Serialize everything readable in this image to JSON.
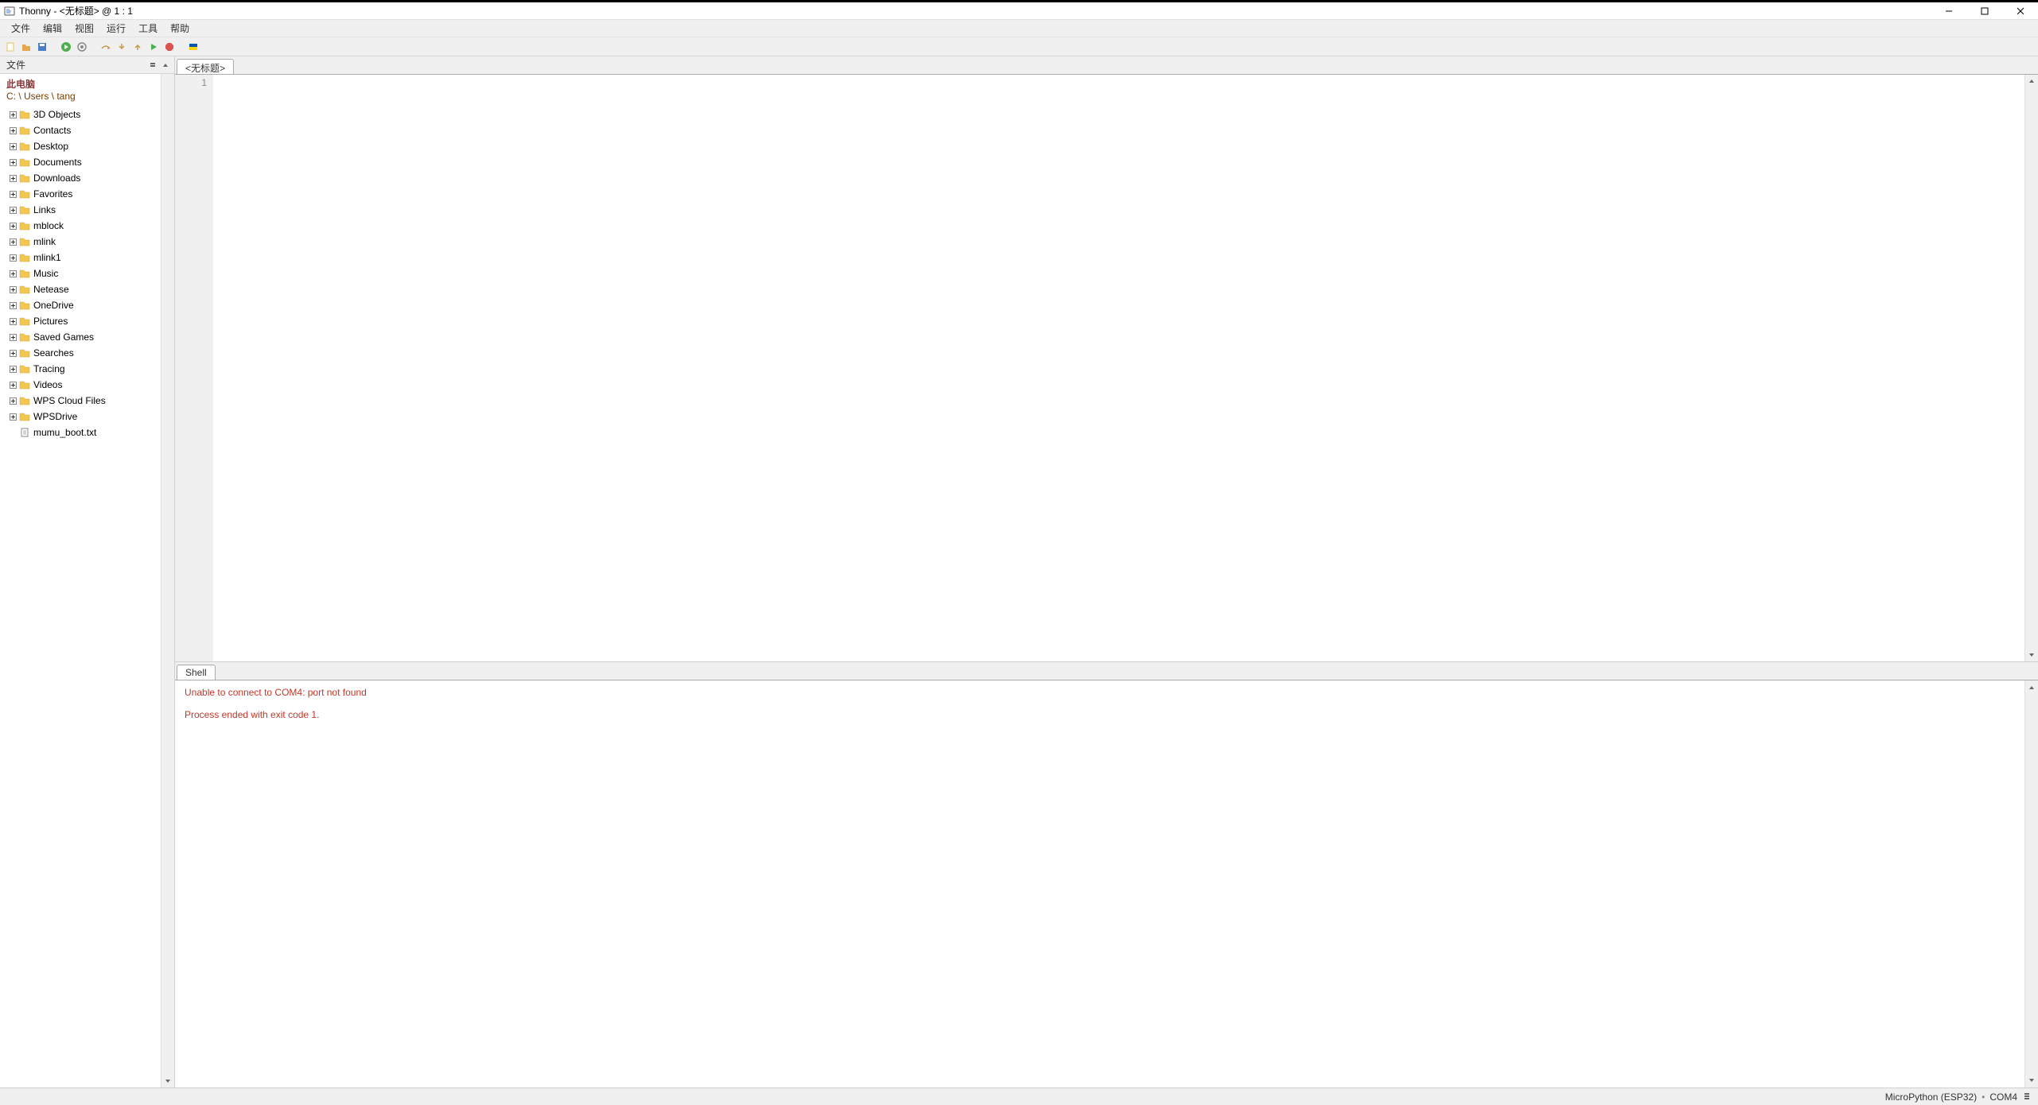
{
  "window": {
    "title": "Thonny  -  <无标题>  @  1 : 1"
  },
  "menu": {
    "items": [
      "文件",
      "编辑",
      "视图",
      "运行",
      "工具",
      "帮助"
    ]
  },
  "toolbar": {
    "buttons": [
      {
        "name": "new-file-icon",
        "color": "#e6c55a"
      },
      {
        "name": "open-file-icon",
        "color": "#e6a64a"
      },
      {
        "name": "save-file-icon",
        "color": "#4a7fc6"
      },
      {
        "name": "run-icon",
        "color": "#4caf50"
      },
      {
        "name": "debug-icon",
        "color": "#888888"
      },
      {
        "name": "step-over-icon",
        "color": "#c29a4a"
      },
      {
        "name": "step-into-icon",
        "color": "#c29a4a"
      },
      {
        "name": "step-out-icon",
        "color": "#c29a4a"
      },
      {
        "name": "resume-icon",
        "color": "#4caf50"
      },
      {
        "name": "stop-icon",
        "color": "#d9534f"
      },
      {
        "name": "support-ukraine-icon",
        "color": "#ffd500"
      }
    ]
  },
  "sidebar": {
    "title": "文件",
    "location_label": "此电脑",
    "path": "C: \\ Users \\ tang",
    "items": [
      {
        "type": "folder",
        "label": "3D Objects"
      },
      {
        "type": "folder",
        "label": "Contacts"
      },
      {
        "type": "folder",
        "label": "Desktop"
      },
      {
        "type": "folder",
        "label": "Documents"
      },
      {
        "type": "folder",
        "label": "Downloads"
      },
      {
        "type": "folder",
        "label": "Favorites"
      },
      {
        "type": "folder",
        "label": "Links"
      },
      {
        "type": "folder",
        "label": "mblock"
      },
      {
        "type": "folder",
        "label": "mlink"
      },
      {
        "type": "folder",
        "label": "mlink1"
      },
      {
        "type": "folder",
        "label": "Music"
      },
      {
        "type": "folder",
        "label": "Netease"
      },
      {
        "type": "folder",
        "label": "OneDrive"
      },
      {
        "type": "folder",
        "label": "Pictures"
      },
      {
        "type": "folder",
        "label": "Saved Games"
      },
      {
        "type": "folder",
        "label": "Searches"
      },
      {
        "type": "folder",
        "label": "Tracing"
      },
      {
        "type": "folder",
        "label": "Videos"
      },
      {
        "type": "folder",
        "label": "WPS Cloud Files"
      },
      {
        "type": "folder",
        "label": "WPSDrive"
      },
      {
        "type": "file",
        "label": "mumu_boot.txt"
      }
    ]
  },
  "editor": {
    "tabs": [
      {
        "label": "<无标题>",
        "active": true
      }
    ],
    "gutter_start": "1"
  },
  "shell": {
    "tab_label": "Shell",
    "lines": [
      "Unable to connect to COM4: port not found",
      "",
      "Process ended with exit code 1."
    ]
  },
  "statusbar": {
    "interpreter": "MicroPython (ESP32)",
    "separator": "•",
    "port": "COM4"
  }
}
